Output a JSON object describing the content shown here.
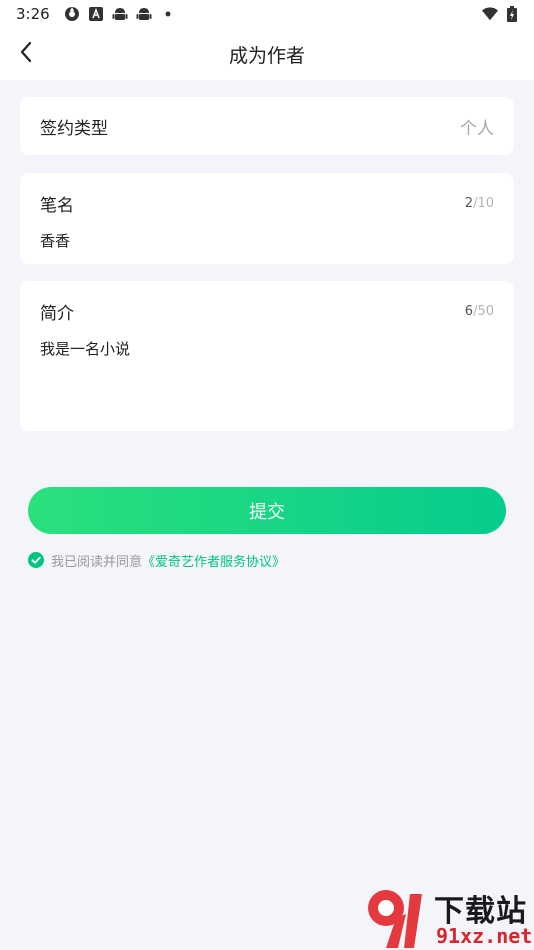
{
  "status_bar": {
    "time": "3:26",
    "left_icons": [
      "gear-icon",
      "a-box-icon",
      "android-icon",
      "android-icon",
      "dot-icon"
    ],
    "right_icons": [
      "wifi-icon",
      "battery-icon"
    ]
  },
  "header": {
    "back_icon": "chevron-left-icon",
    "title": "成为作者"
  },
  "form": {
    "sign_type": {
      "label": "签约类型",
      "value": "个人"
    },
    "pen_name": {
      "label": "笔名",
      "value": "香香",
      "count": "2",
      "max": "/10"
    },
    "intro": {
      "label": "简介",
      "value": "我是一名小说",
      "count": "6",
      "max": "/50"
    }
  },
  "submit": {
    "label": "提交"
  },
  "agreement": {
    "checked": true,
    "text": "我已阅读并同意",
    "link": "《爱奇艺作者服务协议》"
  },
  "watermark": {
    "title": "下载站",
    "url": "91xz.net"
  },
  "colors": {
    "accent": "#00c47f",
    "gradient_start": "#2be07d",
    "gradient_end": "#05cc8c",
    "background": "#f4f5fa",
    "card": "#ffffff"
  }
}
